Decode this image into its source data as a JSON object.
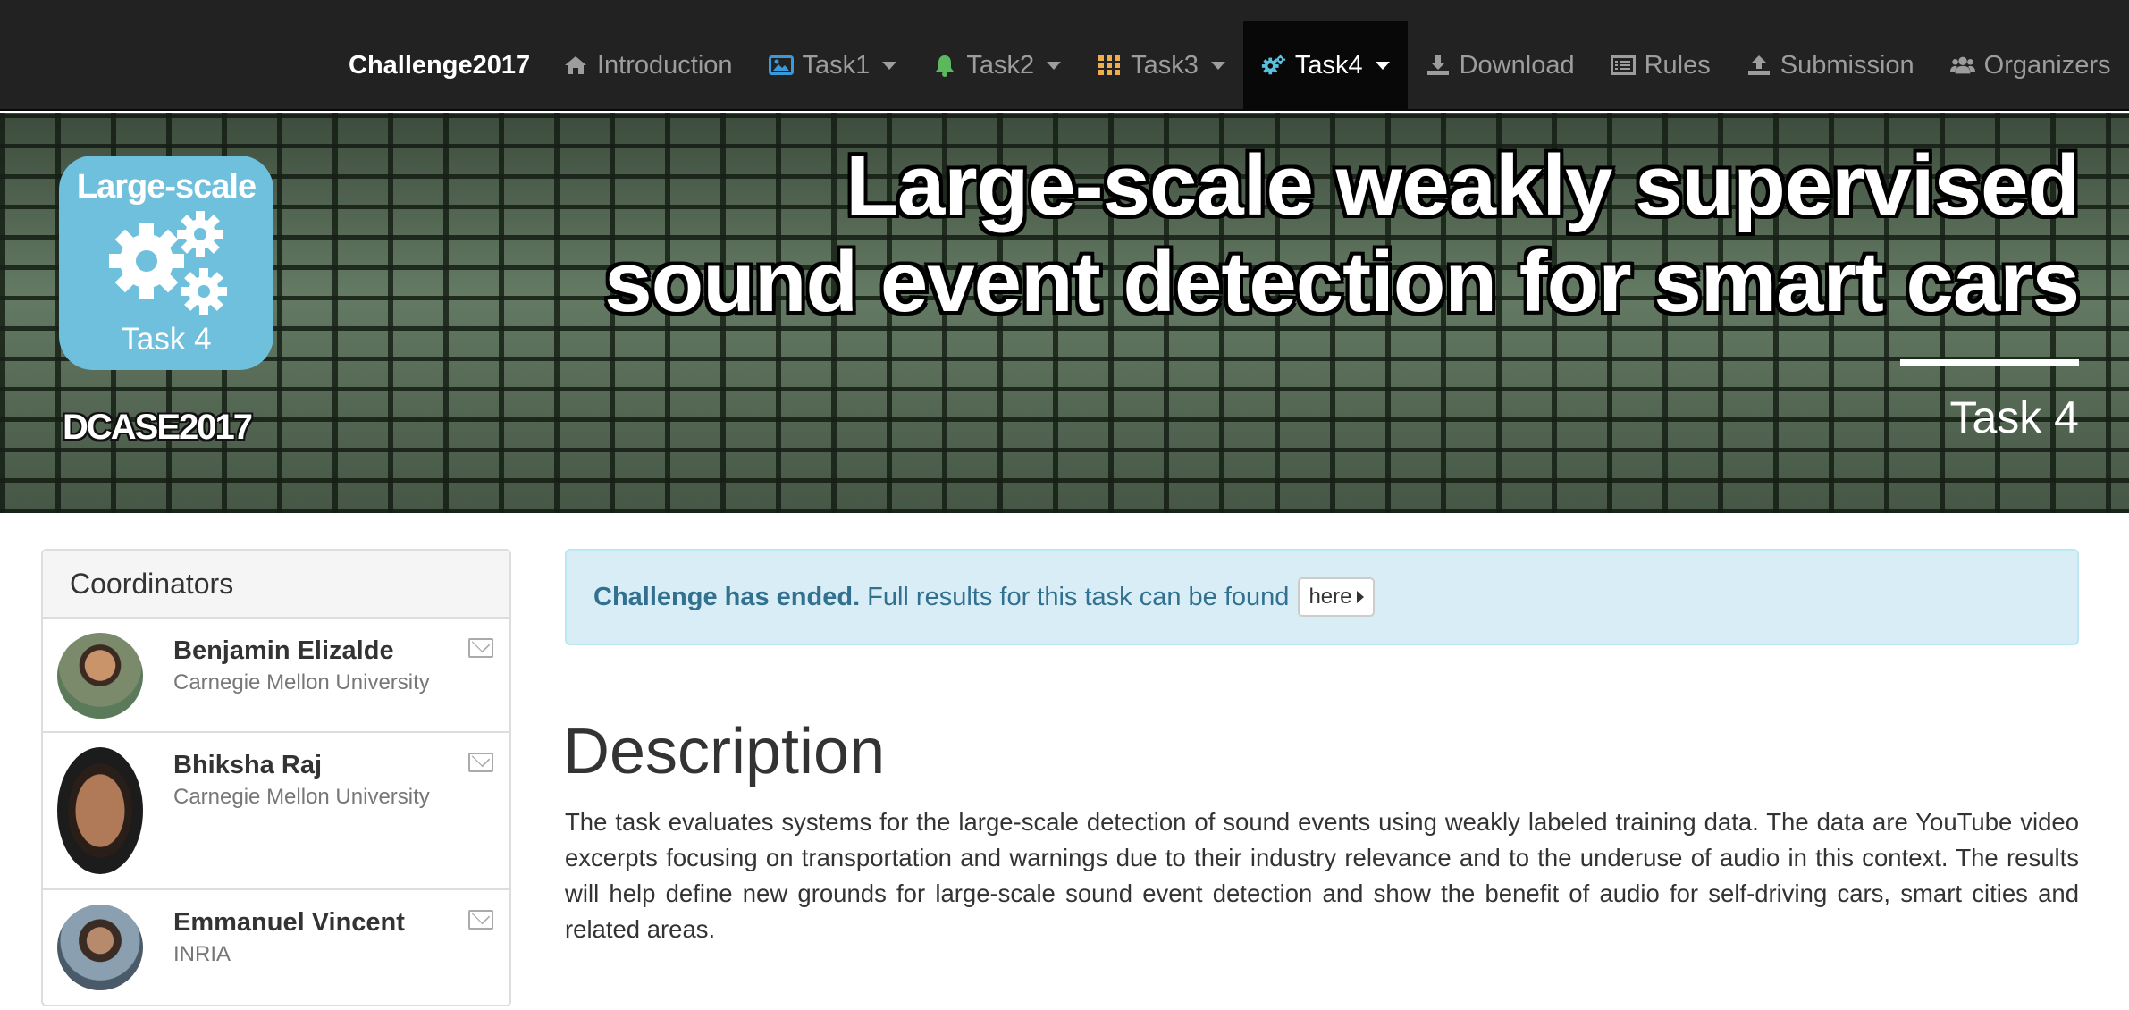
{
  "navbar": {
    "brand": "Challenge2017",
    "items": [
      {
        "label": "Introduction",
        "icon": "home-icon",
        "color": "#9d9d9d"
      },
      {
        "label": "Task1",
        "icon": "image-icon",
        "color": "#3a9ad9"
      },
      {
        "label": "Task2",
        "icon": "bell-icon",
        "color": "#5cb85c"
      },
      {
        "label": "Task3",
        "icon": "grid-icon",
        "color": "#f0ad4e"
      },
      {
        "label": "Task4",
        "icon": "gears-icon",
        "color": "#5bc0de",
        "active": true
      },
      {
        "label": "Download",
        "icon": "download-icon",
        "color": "#9d9d9d"
      },
      {
        "label": "Rules",
        "icon": "list-icon",
        "color": "#9d9d9d"
      },
      {
        "label": "Submission",
        "icon": "upload-icon",
        "color": "#9d9d9d"
      },
      {
        "label": "Organizers",
        "icon": "users-icon",
        "color": "#9d9d9d"
      }
    ]
  },
  "hero": {
    "logo_top": "Large-scale",
    "logo_bottom": "Task 4",
    "dcase": "DCASE2017",
    "title_line1": "Large-scale weakly supervised",
    "title_line2": "sound event detection for smart cars",
    "subtitle": "Task 4"
  },
  "sidebar": {
    "heading": "Coordinators",
    "people": [
      {
        "name": "Benjamin Elizalde",
        "org": "Carnegie Mellon University"
      },
      {
        "name": "Bhiksha Raj",
        "org": "Carnegie Mellon University"
      },
      {
        "name": "Emmanuel Vincent",
        "org": "INRIA"
      }
    ]
  },
  "alert": {
    "strong": "Challenge has ended.",
    "text": "Full results for this task can be found",
    "button": "here"
  },
  "description": {
    "title": "Description",
    "text": "The task evaluates systems for the large-scale detection of sound events using weakly labeled training data. The data are YouTube video excerpts focusing on transportation and warnings due to their industry relevance and to the underuse of audio in this context. The results will help define new grounds for large-scale sound event detection and show the benefit of audio for self-driving cars, smart cities and related areas."
  }
}
